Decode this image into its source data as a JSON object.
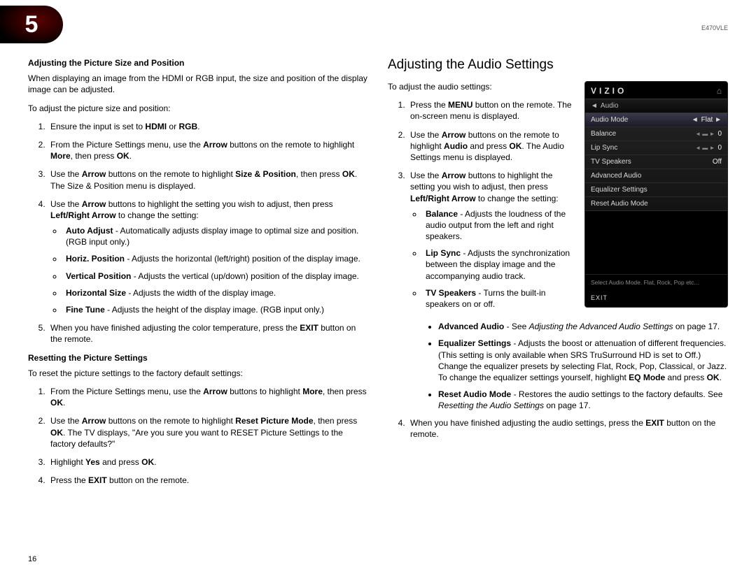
{
  "chapter_num": "5",
  "model": "E470VLE",
  "page_num": "16",
  "left": {
    "heading1": "Adjusting the Picture Size and Position",
    "intro1": "When displaying an image from the HDMI or RGB input, the size and position of the display image can be adjusted.",
    "intro2": "To adjust the picture size and position:",
    "step1_a": "Ensure the input is set to ",
    "step1_b": "HDMI",
    "step1_c": " or ",
    "step1_d": "RGB",
    "step1_e": ".",
    "step2_a": "From the Picture Settings menu, use the ",
    "step2_b": "Arrow",
    "step2_c": " buttons on the remote to highlight ",
    "step2_d": "More",
    "step2_e": ", then press ",
    "step2_f": "OK",
    "step2_g": ".",
    "step3_a": "Use the ",
    "step3_b": "Arrow",
    "step3_c": " buttons on the remote to highlight ",
    "step3_d": "Size & Position",
    "step3_e": ", then press ",
    "step3_f": "OK",
    "step3_g": ". The Size & Position menu is displayed.",
    "step4_a": "Use the ",
    "step4_b": "Arrow",
    "step4_c": " buttons to highlight the setting you wish to adjust, then press ",
    "step4_d": "Left/Right Arrow",
    "step4_e": " to change the setting:",
    "b1_a": "Auto Adjust",
    "b1_b": " - Automatically adjusts display image to optimal size and position. (RGB input only.)",
    "b2_a": "Horiz. Position",
    "b2_b": " - Adjusts the horizontal (left/right) position of the display image.",
    "b3_a": "Vertical Position",
    "b3_b": " - Adjusts the vertical (up/down) position of the display image.",
    "b4_a": "Horizontal Size",
    "b4_b": " - Adjusts the width of the display image.",
    "b5_a": "Fine Tune",
    "b5_b": " - Adjusts the height of the display image. (RGB input only.)",
    "step5_a": "When you have finished adjusting the color temperature, press the ",
    "step5_b": "EXIT",
    "step5_c": " button on the remote.",
    "heading2": "Resetting the Picture Settings",
    "intro3": "To reset the picture settings to the factory default settings:",
    "r1_a": "From the Picture Settings menu, use the ",
    "r1_b": "Arrow",
    "r1_c": " buttons to highlight ",
    "r1_d": "More",
    "r1_e": ", then press ",
    "r1_f": "OK",
    "r1_g": ".",
    "r2_a": "Use the ",
    "r2_b": "Arrow",
    "r2_c": " buttons on the remote to highlight ",
    "r2_d": "Reset Picture Mode",
    "r2_e": ", then press ",
    "r2_f": "OK",
    "r2_g": ". The TV displays, \"Are you sure you want to RESET Picture Settings to the factory defaults?\"",
    "r3_a": "Highlight ",
    "r3_b": "Yes",
    "r3_c": " and press ",
    "r3_d": "OK",
    "r3_e": ".",
    "r4_a": "Press the ",
    "r4_b": "EXIT",
    "r4_c": " button on the remote."
  },
  "right": {
    "title": "Adjusting the Audio Settings",
    "intro": "To adjust the audio settings:",
    "s1_a": "Press the ",
    "s1_b": "MENU",
    "s1_c": " button on the remote. The on-screen menu is displayed.",
    "s2_a": "Use the ",
    "s2_b": "Arrow",
    "s2_c": " buttons on the remote to highlight ",
    "s2_d": "Audio",
    "s2_e": " and press ",
    "s2_f": "OK",
    "s2_g": ". The Audio Settings menu is displayed.",
    "s3_a": "Use the ",
    "s3_b": "Arrow",
    "s3_c": " buttons to highlight the setting you wish to adjust, then press ",
    "s3_d": "Left/Right Arrow",
    "s3_e": " to change the setting:",
    "bb1_a": "Balance",
    "bb1_b": " - Adjusts the loudness of the audio output from the left and right speakers.",
    "bb2_a": "Lip Sync",
    "bb2_b": " - Adjusts the synchronization between the display image and the accompanying audio track.",
    "bb3_a": "TV Speakers",
    "bb3_b": " - Turns the built-in speakers on or off.",
    "bb4_a": "Advanced Audio",
    "bb4_b": " - See ",
    "bb4_c": "Adjusting the Advanced Audio Settings",
    "bb4_d": " on page 17.",
    "bb5_a": "Equalizer Settings",
    "bb5_b": " - Adjusts the boost or attenuation of different frequencies. (This setting is only available when SRS TruSurround HD is set to Off.) Change the equalizer presets by selecting Flat, Rock, Pop, Classical, or Jazz. To change the equalizer settings yourself, highlight ",
    "bb5_c": "EQ Mode",
    "bb5_d": " and press ",
    "bb5_e": "OK",
    "bb5_f": ".",
    "bb6_a": "Reset Audio Mode",
    "bb6_b": " - Restores the audio settings to the factory defaults. See ",
    "bb6_c": "Resetting the Audio Settings",
    "bb6_d": " on page 17.",
    "s4_a": "When you have finished adjusting the audio settings, press the ",
    "s4_b": "EXIT",
    "s4_c": " button on the remote."
  },
  "osd": {
    "logo": "VIZIO",
    "home_icon": "⌂",
    "breadcrumb_chev": "◄",
    "breadcrumb": "Audio",
    "rows": [
      {
        "label": "Audio Mode",
        "left_chev": "◄",
        "val": "Flat",
        "right_chev": "►",
        "highlight": true
      },
      {
        "label": "Balance",
        "arrows": "◄ ▬ ►",
        "val": "0"
      },
      {
        "label": "Lip Sync",
        "arrows": "◄ ▬ ►",
        "val": "0"
      },
      {
        "label": "TV Speakers",
        "val": "Off"
      },
      {
        "label": "Advanced Audio"
      },
      {
        "label": "Equalizer Settings"
      },
      {
        "label": "Reset Audio Mode"
      }
    ],
    "hint": "Select Audio Mode. Flat, Rock, Pop etc...",
    "exit": "EXIT"
  }
}
